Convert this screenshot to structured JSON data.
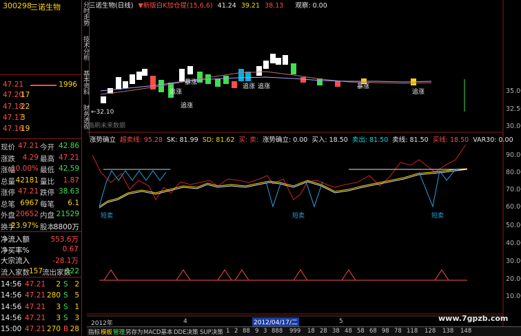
{
  "header": {
    "code": "300298",
    "name": "三诺生物"
  },
  "orderbook": [
    {
      "price": "47.21",
      "vol": "",
      "big": "1996"
    },
    {
      "price": "47.20",
      "vol": "17"
    },
    {
      "price": "47.18",
      "vol": "22"
    },
    {
      "price": "47.17",
      "vol": "3"
    },
    {
      "price": "47.16",
      "vol": "19"
    }
  ],
  "quote": [
    {
      "l1": "现价",
      "v1": "47.21",
      "c1": "r",
      "l2": "今开",
      "v2": "42.86",
      "c2": "g"
    },
    {
      "l1": "涨跌",
      "v1": "4.29",
      "c1": "r",
      "l2": "最高",
      "v2": "47.21",
      "c2": "r"
    },
    {
      "l1": "涨幅",
      "v1": "10.00%",
      "c1": "r",
      "l2": "最低",
      "v2": "42.59",
      "c2": "g"
    },
    {
      "l1": "总量",
      "v1": "42181",
      "c1": "y",
      "l2": "量比",
      "v2": "1.87",
      "c2": "r"
    },
    {
      "l1": "涨停",
      "v1": "47.21",
      "c1": "r",
      "l2": "跌停",
      "v2": "38.63",
      "c2": "g"
    },
    {
      "l1": "总笔",
      "v1": "6967",
      "c1": "y",
      "l2": "每笔",
      "v2": "6.1",
      "c2": "y"
    },
    {
      "l1": "外盘",
      "v1": "20652",
      "c1": "r",
      "l2": "内盘",
      "v2": "21529",
      "c2": "g"
    },
    {
      "l1": "换手",
      "v1": "23.97%",
      "c1": "y",
      "l2": "股本",
      "v2": "8800万",
      "c2": "w"
    }
  ],
  "flows": [
    {
      "label": "净流入额",
      "value": "553.6万",
      "c": "r"
    },
    {
      "label": "净买率%",
      "value": "0.67",
      "c": "r"
    },
    {
      "label": "大宗流入",
      "value": "-28.1万",
      "c": "r"
    }
  ],
  "inout": {
    "l1": "流入家数",
    "v1": "157",
    "l2": "流出家数",
    "v2": "122"
  },
  "ticks": [
    {
      "time": "14:56",
      "price": "47.21",
      "vol": "2",
      "side": "S",
      "n": "2"
    },
    {
      "time": "14:56",
      "price": "47.21",
      "vol": "280",
      "side": "S",
      "n": "5"
    },
    {
      "time": "14:56",
      "price": "47.21",
      "vol": "3",
      "side": "S",
      "n": "1"
    },
    {
      "time": "14:56",
      "price": "47.21",
      "vol": "3",
      "side": "S",
      "n": "3"
    },
    {
      "time": "15:00",
      "price": "47.21",
      "vol": "270",
      "side": "B",
      "n": "28"
    }
  ],
  "tabs": [
    "分时走势",
    "技术分析",
    "基本资料",
    "财务透视"
  ],
  "main_title": {
    "a": "三诺生物(日线)",
    "b": "▼新版白K加仓提(15,6,6)",
    "c": "41.24",
    "d": "39.21",
    "e": "38.13",
    "f": "观察: 0.00"
  },
  "main_axis": [
    "35.00",
    "32.50",
    "30.00"
  ],
  "main_note": "←32.10",
  "main_note2": "画刷未来数据",
  "labels_main": [
    "追涨",
    "追涨",
    "暴涨",
    "追涨",
    "追涨",
    "暴涨",
    "追涨"
  ],
  "ind_title": {
    "a": "涨势确立",
    "b": "超卖线: 95.28",
    "c": "SK: 81.99",
    "d": "SD: 81.62",
    "e": "买: 卖:",
    "f": "涨势确立: 0.00",
    "g": "买入: 18.50",
    "h": "卖出: 81.50",
    "i": "卖线: 81.50",
    "j": "买线: 18.50",
    "k": "VAR30: 0.00"
  },
  "ind_axis": [
    "90.00",
    "80.00",
    "70.00",
    "60.00",
    "50.00",
    "40.00",
    "30.00",
    "20.00",
    "10.00"
  ],
  "ind_labels": [
    "短卖",
    "短卖",
    "短卖"
  ],
  "time_labels": {
    "y": "2012年",
    "m4": "4",
    "sel": "2012/04/17/二",
    "m5": "5"
  },
  "bottom_tabs": [
    "指标",
    "模板",
    "管理",
    "另存为",
    "MACD基本",
    "DDE决策",
    "SUP决策",
    "1",
    "2",
    "88",
    "9",
    "3",
    "888",
    "999",
    "18",
    "28",
    "38",
    "48",
    "58",
    "68",
    "98",
    "78",
    "118",
    "128",
    "138",
    "148"
  ],
  "watermark": "www.7gpzb.com",
  "colors": {
    "up": "#ff4b4b",
    "down": "#3fe04f",
    "yellow": "#ffd700",
    "cyan": "#00e0e0",
    "grid": "#8a1a1a"
  }
}
